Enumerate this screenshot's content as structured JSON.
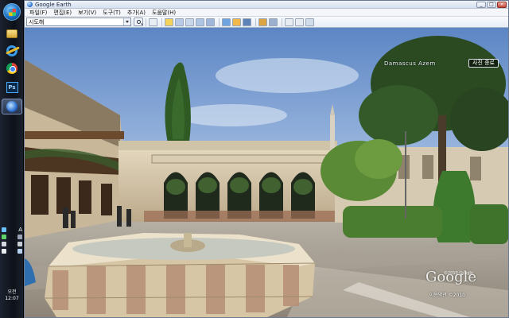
{
  "taskbar": {
    "buttons": [
      {
        "name": "explorer",
        "icon": "folder-icon"
      },
      {
        "name": "ie",
        "icon": "internet-explorer-icon"
      },
      {
        "name": "chrome",
        "icon": "chrome-icon"
      },
      {
        "name": "photoshop",
        "icon": "photoshop-icon",
        "label": "Ps"
      },
      {
        "name": "google-earth",
        "icon": "google-earth-icon"
      }
    ],
    "tray_letter": "A",
    "clock": {
      "line1": "오전 12:07"
    }
  },
  "window": {
    "title": "Google Earth",
    "controls": {
      "minimize": "_",
      "maximize": "□",
      "close": "×"
    }
  },
  "menu": {
    "items": [
      "파일(F)",
      "편집(E)",
      "보기(V)",
      "도구(T)",
      "추가(A)",
      "도움말(H)"
    ]
  },
  "toolbar": {
    "search_value": "시도해",
    "search_icon": "search-icon"
  },
  "viewport": {
    "location": "Damascus Azem",
    "exit_photo_label": "사진 종료",
    "copyright": "©2010 Google",
    "logo": "Google",
    "terms": "이용약관  ©2010"
  },
  "colors": {
    "sky": "#6f98d0",
    "stone": "#cfc2a6",
    "foliage": "#3f6a2c",
    "pool_water": "#c9ccc4"
  }
}
